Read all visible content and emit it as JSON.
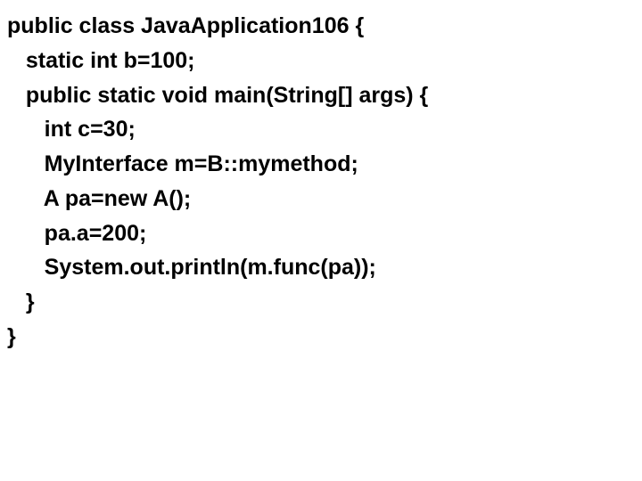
{
  "code": {
    "lines": [
      "public class JavaApplication106 {",
      "   static int b=100;",
      "   public static void main(String[] args) {",
      "      int c=30;",
      "      MyInterface m=B::mymethod;",
      "      A pa=new A();",
      "      pa.a=200;",
      "      System.out.println(m.func(pa));",
      "   }",
      "}"
    ]
  }
}
